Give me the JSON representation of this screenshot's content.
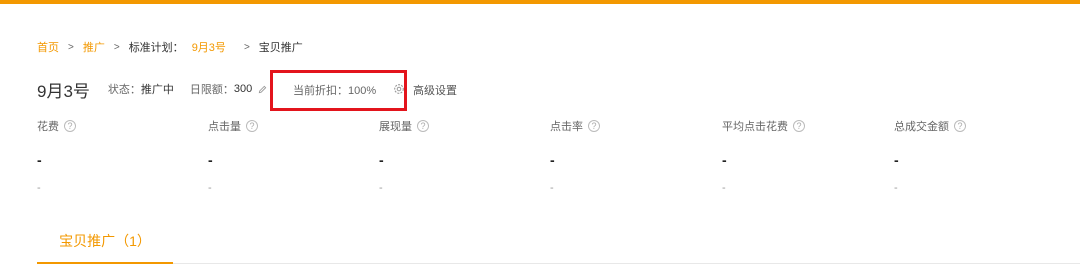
{
  "colors": {
    "accent": "#f39800",
    "highlight_box": "#e3141c"
  },
  "breadcrumb": {
    "home": "首页",
    "promotion": "推广",
    "plan_label": "标准计划：",
    "plan_name": "9月3号",
    "current": "宝贝推广",
    "separator": ">"
  },
  "plan": {
    "title": "9月3号",
    "status_label": "状态：",
    "status_value": "推广中",
    "limit_label": "日限额：",
    "limit_value": "300",
    "discount_label": "当前折扣：",
    "discount_value": "100%",
    "advanced_label": "高级设置",
    "icons": {
      "edit": "pencil-icon",
      "settings": "gear-icon"
    }
  },
  "metrics": [
    {
      "label": "花费",
      "value": "-",
      "compare": "-"
    },
    {
      "label": "点击量",
      "value": "-",
      "compare": "-"
    },
    {
      "label": "展现量",
      "value": "-",
      "compare": "-"
    },
    {
      "label": "点击率",
      "value": "-",
      "compare": "-"
    },
    {
      "label": "平均点击花费",
      "value": "-",
      "compare": "-"
    },
    {
      "label": "总成交金额",
      "value": "-",
      "compare": "-"
    }
  ],
  "help_icon_glyph": "?",
  "tabs": [
    {
      "label": "宝贝推广（1）",
      "active": true
    }
  ]
}
